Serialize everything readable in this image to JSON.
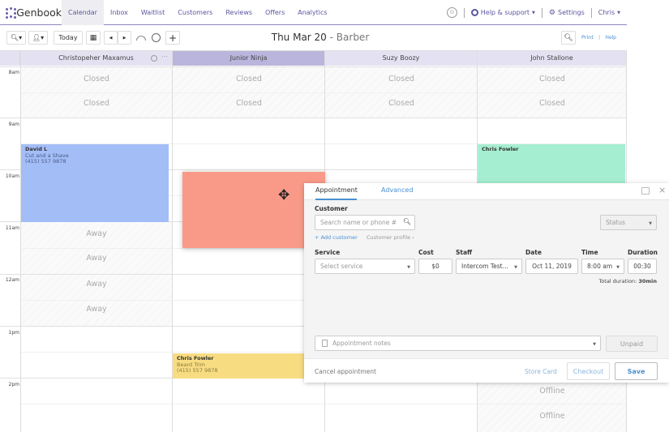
{
  "app": {
    "brand": "Genbook"
  },
  "nav": {
    "items": [
      {
        "label": "Calendar",
        "active": true
      },
      {
        "label": "Inbox"
      },
      {
        "label": "Waitlist"
      },
      {
        "label": "Customers"
      },
      {
        "label": "Reviews"
      },
      {
        "label": "Offers"
      },
      {
        "label": "Analytics"
      }
    ],
    "help_label": "Help & support",
    "settings_label": "Settings",
    "user_label": "Chris"
  },
  "toolbar": {
    "today_label": "Today",
    "date_title": "Thu Mar 20",
    "date_sep": " - ",
    "date_subtitle": "Barber",
    "print_label": "Print",
    "help_label": "Help"
  },
  "calendar": {
    "time_labels": [
      "8am",
      "9am",
      "10am",
      "11am",
      "12am",
      "1pm",
      "2pm"
    ],
    "columns": [
      {
        "name": "Christopeher Maxamus"
      },
      {
        "name": "Junior Ninja",
        "selected": true
      },
      {
        "name": "Suzy Boozy"
      },
      {
        "name": "John Stallone"
      }
    ],
    "closed_label": "Closed",
    "away_label": "Away",
    "offline_label": "Offline",
    "appointments": [
      {
        "customer": "David L",
        "service": "Cut and a Shave",
        "phone": "(415) 557 9878",
        "color": "#a3bdf7"
      },
      {
        "customer": "Chris Fowler",
        "service": "Beard Trim",
        "phone": "(415) 557 9878",
        "color": "#f8dc82"
      },
      {
        "customer": "Chris Fowler",
        "color": "#a6eed2"
      },
      {
        "color": "#f99a88"
      }
    ]
  },
  "panel": {
    "tabs": [
      {
        "label": "Appointment",
        "active": true
      },
      {
        "label": "Advanced"
      }
    ],
    "customer_label": "Customer",
    "search_placeholder": "Search name or phone #",
    "status_placeholder": "Status",
    "add_customer": "+ Add customer",
    "customer_profile": "Customer profile ›",
    "service_label": "Service",
    "service_placeholder": "Select service",
    "cost_label": "Cost",
    "cost_value": "$0",
    "staff_label": "Staff",
    "staff_value": "Intercom Test...",
    "date_label": "Date",
    "date_value": "Oct 11, 2019",
    "time_label": "Time",
    "time_value": "8:00 am",
    "duration_label": "Duration",
    "duration_value": "00:30",
    "total_duration_label": "Total duration:",
    "total_duration_value": "30min",
    "notes_placeholder": "Appointment notes",
    "unpaid_label": "Unpaid",
    "cancel_label": "Cancel appointment",
    "store_card_label": "Store Card",
    "checkout_label": "Checkout",
    "save_label": "Save"
  }
}
